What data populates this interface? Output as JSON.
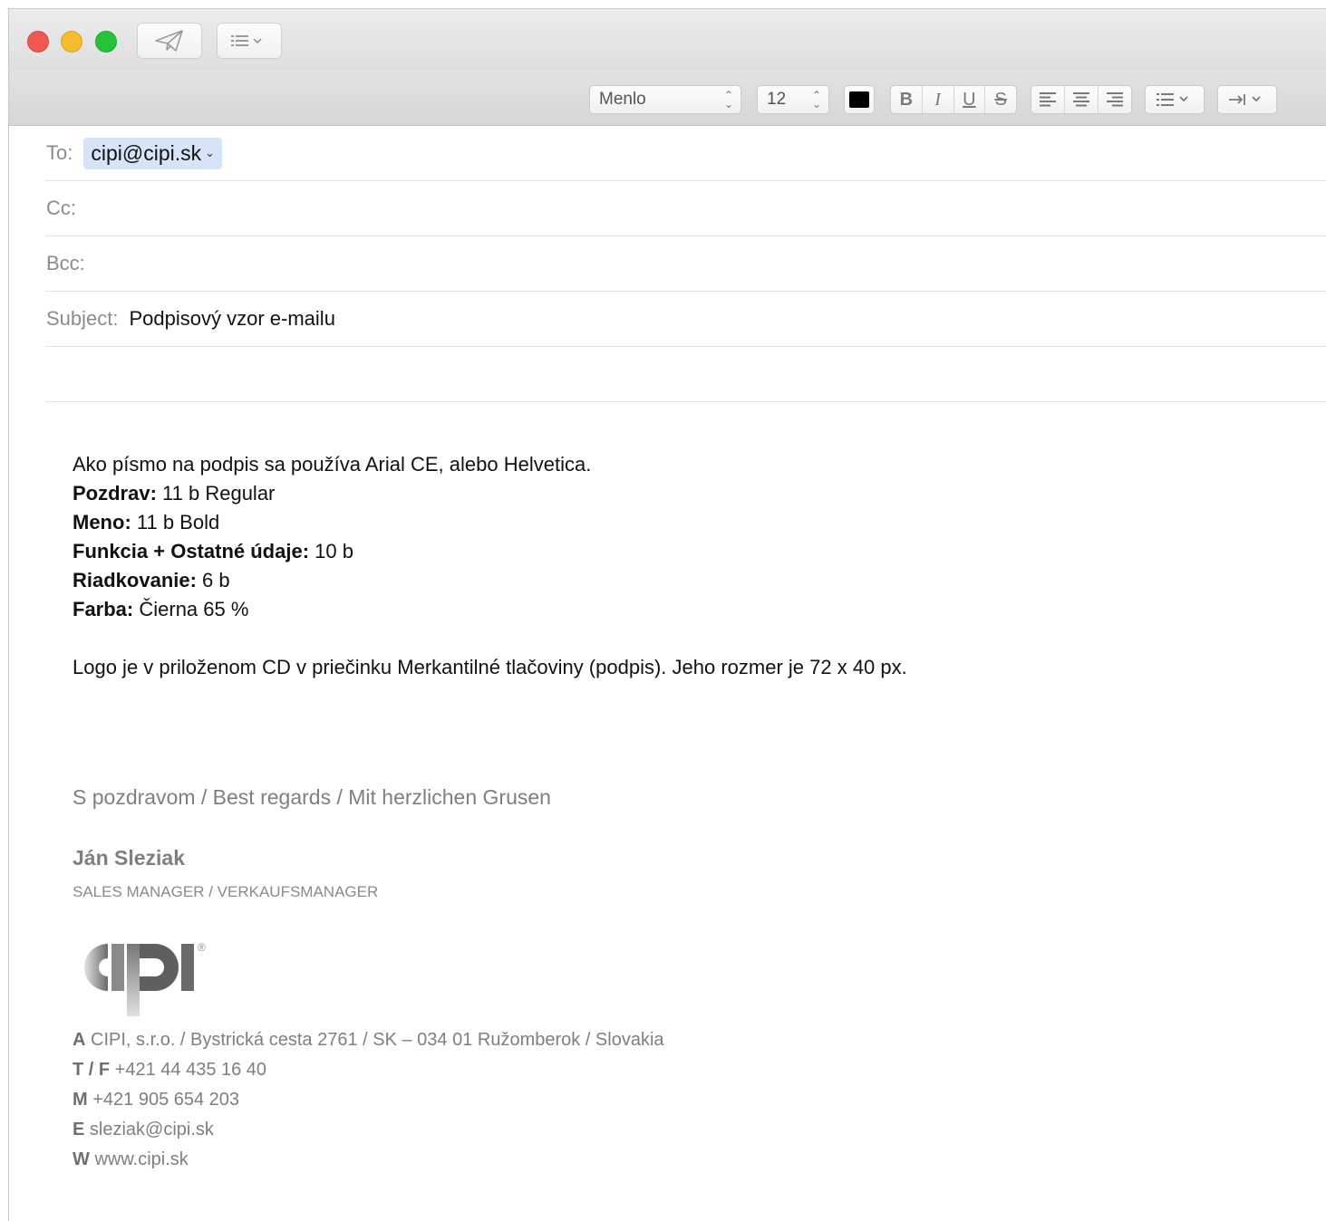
{
  "toolbar": {
    "send_icon": "paper-plane-icon",
    "header_fields_icon": "list-dropdown-icon"
  },
  "format_bar": {
    "font": "Menlo",
    "size": "12",
    "color": "#000000",
    "bold": "B",
    "italic": "I",
    "underline": "U",
    "strike": "S"
  },
  "headers": {
    "to_label": "To:",
    "to_value": "cipi@cipi.sk",
    "cc_label": "Cc:",
    "bcc_label": "Bcc:",
    "subject_label": "Subject:",
    "subject_value": "Podpisový vzor e-mailu"
  },
  "body": {
    "intro": "Ako písmo na podpis sa používa Arial CE, alebo Helvetica.",
    "specs": [
      {
        "label": "Pozdrav:",
        "value": " 11 b Regular"
      },
      {
        "label": "Meno:",
        "value": " 11 b Bold"
      },
      {
        "label": "Funkcia + Ostatné údaje:",
        "value": " 10 b"
      },
      {
        "label": "Riadkovanie:",
        "value": " 6 b"
      },
      {
        "label": "Farba:",
        "value": " Čierna 65 %"
      }
    ],
    "logo_note": "Logo je v priloženom CD v priečinku Merkantilné tlačoviny (podpis). Jeho rozmer je 72 x 40 px."
  },
  "signature": {
    "greeting": "S pozdravom / Best regards / Mit  herzlichen Grusen",
    "name": "Ján Sleziak",
    "title": "SALES MANAGER / VERKAUFSMANAGER",
    "logo_mark": "®",
    "contacts": [
      {
        "label": "A",
        "value": " CIPI, s.r.o. / Bystrická cesta 2761 / SK – 034 01 Ružomberok / Slovakia"
      },
      {
        "label": "T / F",
        "value": " +421 44 435 16 40"
      },
      {
        "label": "M",
        "value": " +421 905 654 203"
      },
      {
        "label": "E",
        "value": " sleziak@cipi.sk"
      },
      {
        "label": "W",
        "value": " www.cipi.sk"
      }
    ]
  }
}
